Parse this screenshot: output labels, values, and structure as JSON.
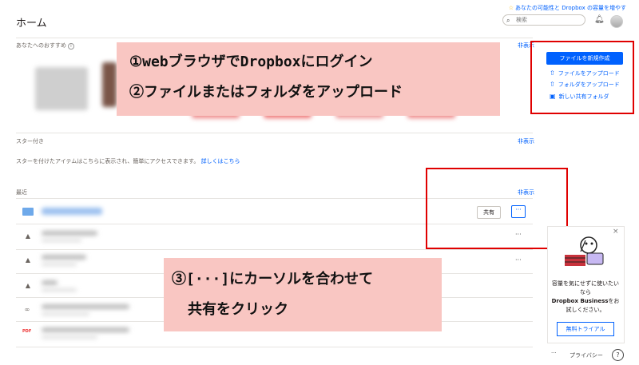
{
  "header": {
    "title": "ホーム",
    "top_notice": "あなたの可能性と Dropbox の容量を増やす",
    "search_placeholder": "検索"
  },
  "recommended": {
    "label": "あなたへのおすすめ",
    "hide": "非表示"
  },
  "callout1": {
    "line1": "①webブラウザでDropboxにログイン",
    "line2": "②ファイルまたはフォルダをアップロード"
  },
  "actions": {
    "create": "ファイルを新規作成",
    "upload_file": "ファイルをアップロード",
    "upload_folder": "フォルダをアップロード",
    "new_shared_folder": "新しい共有フォルダ"
  },
  "starred": {
    "label": "スター付き",
    "hide": "非表示",
    "empty_text": "スターを付けたアイテムはこちらに表示され、簡単にアクセスできます。",
    "learn_more": "詳しくはこちら"
  },
  "recent": {
    "label": "最近",
    "hide": "非表示",
    "share_button": "共有",
    "more_button": "···"
  },
  "callout2": {
    "line1": "③[···]にカーソルを合わせて",
    "line2": "共有をクリック"
  },
  "promo": {
    "text1": "容量を気にせずに使いたいなら",
    "brand": "Dropbox Business",
    "text2": "をお試しください。",
    "button": "無料トライアル"
  },
  "footer": {
    "more": "···",
    "privacy": "プライバシー",
    "help": "?"
  },
  "icons": {
    "search": "search-icon",
    "bell": "bell-icon",
    "close": "close-icon"
  },
  "colors": {
    "accent": "#0061fe",
    "callout": "#f9c6c2",
    "highlight_box": "#e00000"
  }
}
